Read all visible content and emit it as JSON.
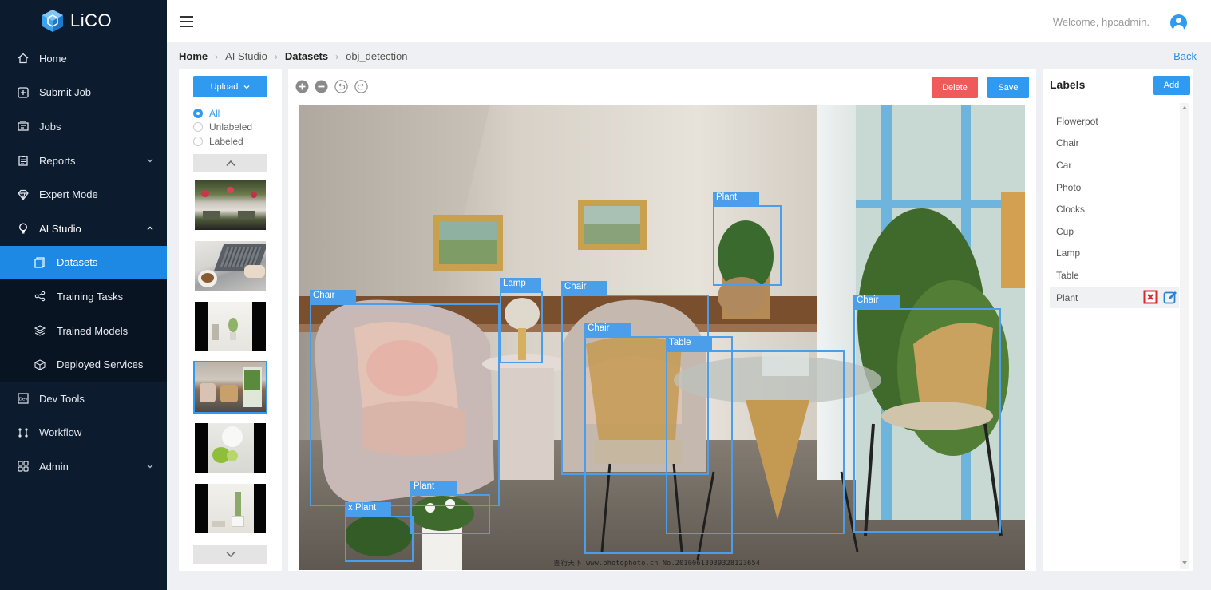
{
  "app": {
    "name": "LiCO"
  },
  "sidebar": {
    "items": [
      {
        "label": "Home",
        "icon": "home-icon"
      },
      {
        "label": "Submit Job",
        "icon": "plus-square-icon"
      },
      {
        "label": "Jobs",
        "icon": "jobs-icon"
      },
      {
        "label": "Reports",
        "icon": "clipboard-icon",
        "expandable": true
      },
      {
        "label": "Expert Mode",
        "icon": "diamond-icon"
      },
      {
        "label": "AI Studio",
        "icon": "bulb-icon",
        "expanded": true,
        "children": [
          {
            "label": "Datasets",
            "icon": "datasets-icon",
            "active": true
          },
          {
            "label": "Training Tasks",
            "icon": "share-icon"
          },
          {
            "label": "Trained Models",
            "icon": "layers-icon"
          },
          {
            "label": "Deployed Services",
            "icon": "cube-icon"
          }
        ]
      },
      {
        "label": "Dev Tools",
        "icon": "dev-icon"
      },
      {
        "label": "Workflow",
        "icon": "workflow-icon"
      },
      {
        "label": "Admin",
        "icon": "grid-icon",
        "expandable": true
      }
    ]
  },
  "header": {
    "welcome": "Welcome, hpcadmin."
  },
  "breadcrumb": {
    "items": [
      "Home",
      "AI Studio",
      "Datasets",
      "obj_detection"
    ],
    "back": "Back"
  },
  "left_panel": {
    "upload_label": "Upload",
    "filters": [
      "All",
      "Unlabeled",
      "Labeled"
    ],
    "selected_filter": "All",
    "thumbnails": 6,
    "selected_thumbnail": 4
  },
  "toolbar": {
    "tools": [
      "zoom-in-icon",
      "zoom-out-icon",
      "undo-icon",
      "redo-icon"
    ],
    "delete_label": "Delete",
    "save_label": "Save"
  },
  "annotations": [
    {
      "label": "Plant"
    },
    {
      "label": "Lamp"
    },
    {
      "label": "Chair"
    },
    {
      "label": "Chair"
    },
    {
      "label": "Chair"
    },
    {
      "label": "Table"
    },
    {
      "label": "Chair"
    },
    {
      "label": "Plant"
    },
    {
      "label": "x Plant"
    }
  ],
  "image_watermark": "图行天下 www.photophoto.cn  No.20100613039328123654",
  "labels_panel": {
    "title": "Labels",
    "add_label": "Add",
    "labels": [
      "Flowerpot",
      "Chair",
      "Car",
      "Photo",
      "Clocks",
      "Cup",
      "Lamp",
      "Table",
      "Plant"
    ],
    "hovered": "Plant"
  },
  "colors": {
    "accent": "#2f9af0",
    "sidebar_bg": "#0d1b2e",
    "active_nav": "#1e88e5",
    "delete": "#ef5a5a",
    "bbox": "#4a9eea"
  }
}
